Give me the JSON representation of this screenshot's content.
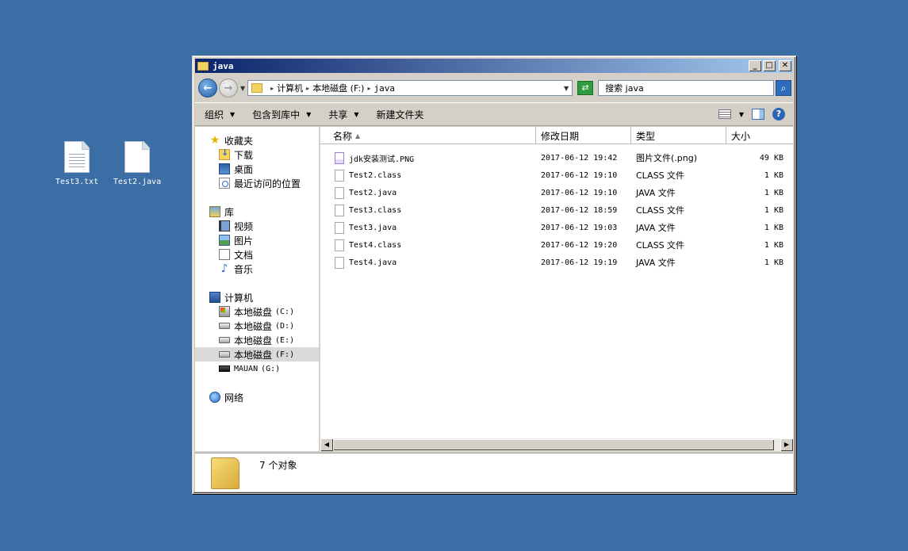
{
  "desktop": {
    "icons": [
      {
        "label": "Test3.txt"
      },
      {
        "label": "Test2.java"
      }
    ]
  },
  "window": {
    "title": "java",
    "buttons": {
      "minimize": "_",
      "maximize": "□",
      "close": "✕"
    }
  },
  "address": {
    "crumbs": [
      "计算机",
      "本地磁盘 (F:)",
      "java"
    ],
    "search_placeholder": "搜索 java"
  },
  "toolbar": {
    "organize": "组织",
    "include_library": "包含到库中",
    "share": "共享",
    "new_folder": "新建文件夹"
  },
  "nav": {
    "favorites": {
      "label": "收藏夹",
      "items": [
        "下载",
        "桌面",
        "最近访问的位置"
      ]
    },
    "libraries": {
      "label": "库",
      "items": [
        "视频",
        "图片",
        "文档",
        "音乐"
      ]
    },
    "computer": {
      "label": "计算机",
      "drives": [
        {
          "label": "本地磁盘",
          "letter": "(C:)"
        },
        {
          "label": "本地磁盘",
          "letter": "(D:)"
        },
        {
          "label": "本地磁盘",
          "letter": "(E:)"
        },
        {
          "label": "本地磁盘",
          "letter": "(F:)"
        },
        {
          "label": "MAUAN",
          "letter": "(G:)"
        }
      ]
    },
    "network": {
      "label": "网络"
    }
  },
  "columns": {
    "name": "名称",
    "date": "修改日期",
    "type": "类型",
    "size": "大小"
  },
  "files": [
    {
      "name": "jdk安装测试.PNG",
      "date": "2017-06-12 19:42",
      "type": "图片文件(.png)",
      "size": "49 KB"
    },
    {
      "name": "Test2.class",
      "date": "2017-06-12 19:10",
      "type": "CLASS 文件",
      "size": "1 KB"
    },
    {
      "name": "Test2.java",
      "date": "2017-06-12 19:10",
      "type": "JAVA 文件",
      "size": "1 KB"
    },
    {
      "name": "Test3.class",
      "date": "2017-06-12 18:59",
      "type": "CLASS 文件",
      "size": "1 KB"
    },
    {
      "name": "Test3.java",
      "date": "2017-06-12 19:03",
      "type": "JAVA 文件",
      "size": "1 KB"
    },
    {
      "name": "Test4.class",
      "date": "2017-06-12 19:20",
      "type": "CLASS 文件",
      "size": "1 KB"
    },
    {
      "name": "Test4.java",
      "date": "2017-06-12 19:19",
      "type": "JAVA 文件",
      "size": "1 KB"
    }
  ],
  "status": {
    "count_text": "7 个对象"
  }
}
